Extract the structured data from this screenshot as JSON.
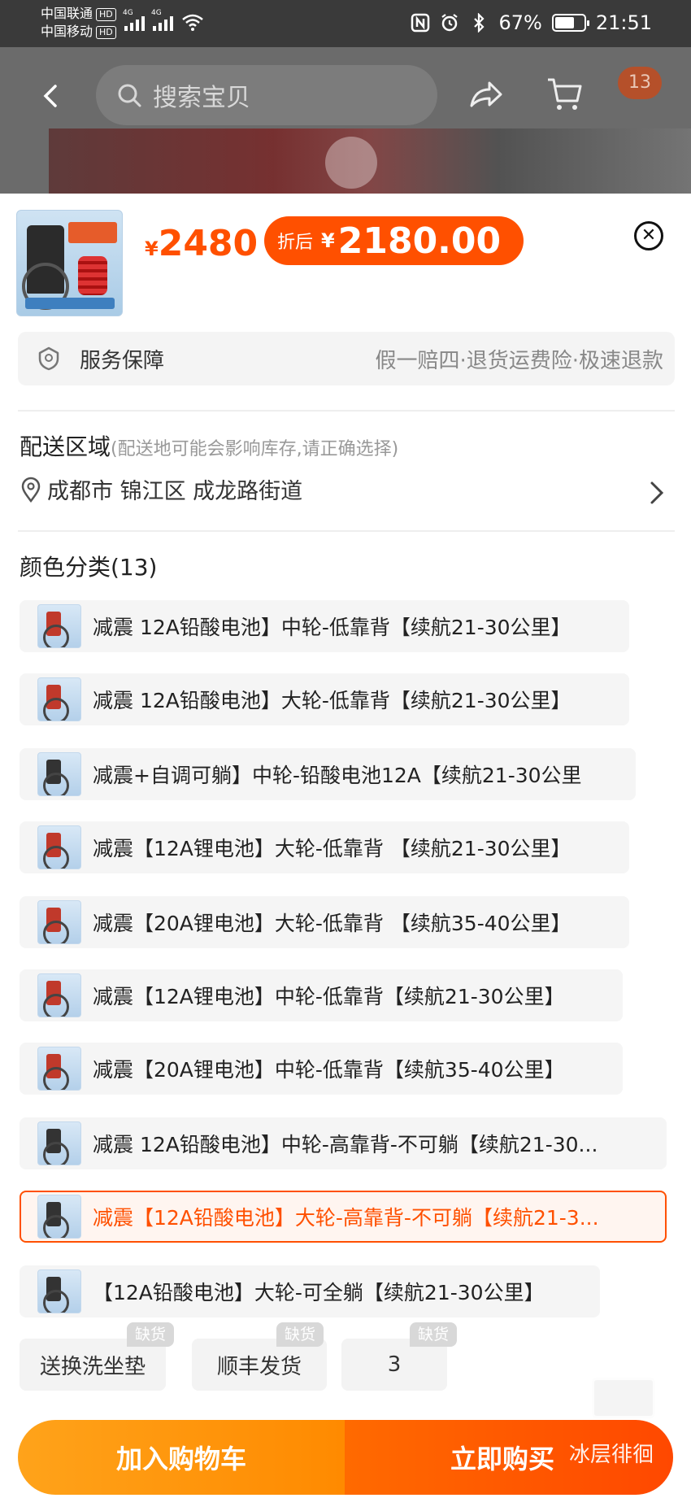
{
  "status_bar": {
    "carrier1": "中国联通",
    "carrier2": "中国移动",
    "hd": "HD",
    "net1": "4G",
    "net2": "4G",
    "battery_pct": "67%",
    "battery_level": 0.67,
    "time": "21:51"
  },
  "header": {
    "search_placeholder": "搜索宝贝",
    "cart_count": "13"
  },
  "sheet": {
    "price_symbol": "¥",
    "price_original": "2480",
    "discount_prefix": "折后",
    "price_discount": "2180.00",
    "service_label": "服务保障",
    "service_detail": "假一赔四·退货运费险·极速退款",
    "delivery_title": "配送区域",
    "delivery_hint": "(配送地可能会影响库存,请正确选择)",
    "delivery_address": "成都市 锦江区 成龙路街道",
    "color_title": "颜色分类(13)"
  },
  "options": [
    "减震 12A铅酸电池】中轮-低靠背【续航21-30公里】",
    "减震 12A铅酸电池】大轮-低靠背【续航21-30公里】",
    "减震+自调可躺】中轮-铅酸电池12A【续航21-30公里",
    "减震【12A锂电池】大轮-低靠背 【续航21-30公里】",
    "减震【20A锂电池】大轮-低靠背 【续航35-40公里】",
    "减震【12A锂电池】中轮-低靠背【续航21-30公里】",
    "减震【20A锂电池】中轮-低靠背【续航35-40公里】",
    "减震 12A铅酸电池】中轮-高靠背-不可躺【续航21-30...",
    "减震【12A铅酸电池】大轮-高靠背-不可躺【续航21-3...",
    "【12A铅酸电池】大轮-可全躺【续航21-30公里】"
  ],
  "selected_option_index": 8,
  "extras": {
    "items": [
      "送换洗坐垫",
      "顺丰发货",
      "3"
    ],
    "badge": "缺货"
  },
  "buttons": {
    "add_to_cart": "加入购物车",
    "buy_now": "立即购买"
  },
  "watermark": "冰层徘徊",
  "colors": {
    "accent": "#ff5000",
    "cart_button": "#ff9500",
    "status_bar_bg": "#3a3a3a"
  }
}
